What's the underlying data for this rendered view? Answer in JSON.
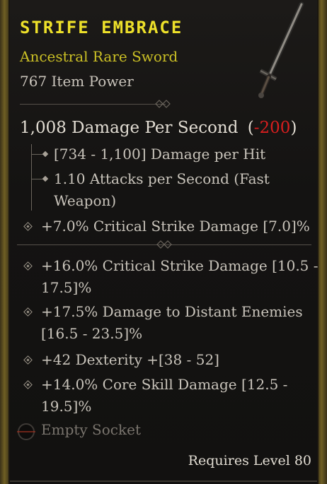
{
  "item": {
    "name": "STRIFE EMBRACE",
    "type": "Ancestral Rare Sword",
    "item_power": "767 Item Power"
  },
  "dps": {
    "value": "1,008 Damage Per Second",
    "paren_open": "(",
    "delta": "-200",
    "paren_close": ")"
  },
  "weapon_stats": [
    "[734 - 1,100] Damage per Hit",
    "1.10 Attacks per Second (Fast",
    "Weapon)"
  ],
  "implicit_affix": "+7.0% Critical Strike Damage [7.0]%",
  "affixes": [
    {
      "line1": "+16.0% Critical Strike Damage [10.5 -",
      "line2": "17.5]%"
    },
    {
      "line1": "+17.5% Damage to Distant Enemies",
      "line2": "[16.5 - 23.5]%"
    },
    {
      "line1": "+42 Dexterity +[38 - 52]",
      "line2": ""
    },
    {
      "line1": "+14.0% Core Skill Damage [12.5 -",
      "line2": "19.5]%"
    }
  ],
  "socket": {
    "label": "Empty Socket",
    "icon": "empty-socket-icon"
  },
  "requirement": "Requires Level 80",
  "colors": {
    "title": "#ede02a",
    "rarity": "#cbc025",
    "negative": "#d81e1e",
    "rail": "#6f5f24"
  },
  "icons": {
    "item": "sword-icon",
    "divider": "divider-ornament-icon",
    "bullet": "diamond-bullet-icon"
  }
}
